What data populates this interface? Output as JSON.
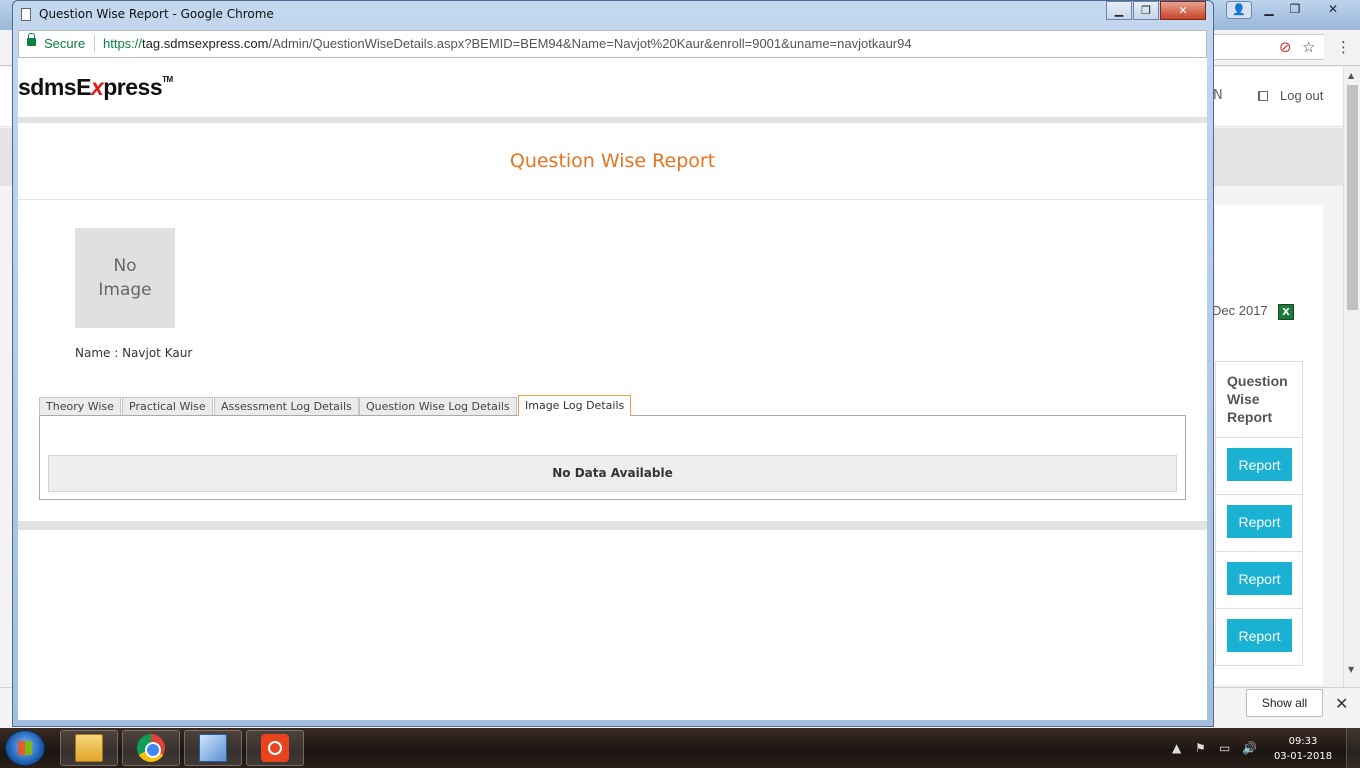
{
  "popup": {
    "window_title": "Question Wise Report - Google Chrome",
    "secure_label": "Secure",
    "url_scheme": "https://",
    "url_host": "tag.sdmsexpress.com",
    "url_path": "/Admin/QuestionWiseDetails.aspx?BEMID=BEM94&Name=Navjot%20Kaur&enroll=9001&uname=navjotkaur94"
  },
  "logo": {
    "part1": "sdmsE",
    "part2": "x",
    "part3": "press",
    "tm": "TM"
  },
  "report": {
    "title": "Question Wise Report",
    "no_image_line1": "No",
    "no_image_line2": "Image",
    "name_line": "Name : Navjot Kaur",
    "tabs": [
      {
        "label": "Theory Wise"
      },
      {
        "label": "Practical Wise"
      },
      {
        "label": "Assessment Log Details"
      },
      {
        "label": "Question Wise Log Details"
      },
      {
        "label": "Image Log Details"
      }
    ],
    "active_tab": "Image Log Details",
    "no_data": "No Data Available"
  },
  "background": {
    "header_partial": "N",
    "logout_label": "Log out",
    "date_partial": "Dec 2017",
    "excel_icon": "excel-icon",
    "table_header": "Question Wise Report",
    "report_buttons": [
      "Report",
      "Report",
      "Report",
      "Report"
    ],
    "show_all": "Show all"
  },
  "taskbar": {
    "time": "09:33",
    "date": "03-01-2018"
  },
  "colors": {
    "title_orange": "#e87320",
    "report_button": "#1bb1d3",
    "secure_green": "#0b8043"
  }
}
